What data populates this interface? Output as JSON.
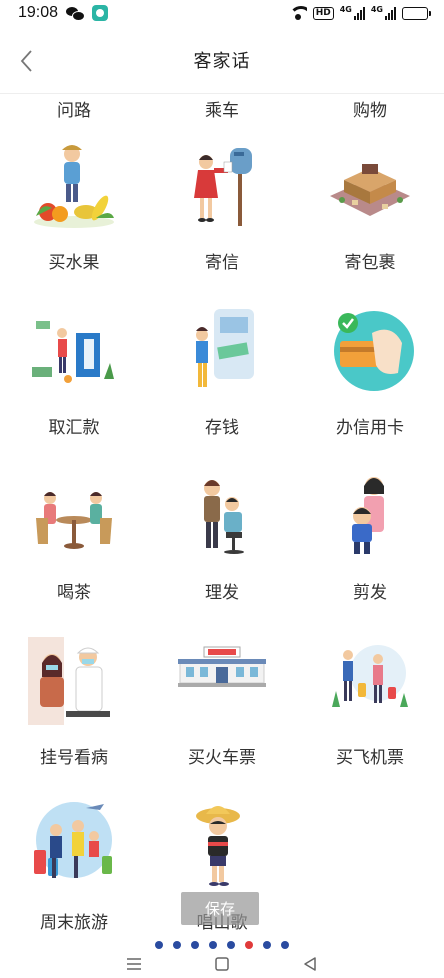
{
  "status_bar": {
    "time": "19:08",
    "hd_label": "HD",
    "signal_1": "4G",
    "signal_2": "4G"
  },
  "header": {
    "title": "客家话"
  },
  "partial_row": [
    "问路",
    "乘车",
    "购物"
  ],
  "grid": [
    [
      "买水果",
      "寄信",
      "寄包裹"
    ],
    [
      "取汇款",
      "存钱",
      "办信用卡"
    ],
    [
      "喝茶",
      "理发",
      "剪发"
    ],
    [
      "挂号看病",
      "买火车票",
      "买飞机票"
    ],
    [
      "周末旅游",
      "唱山歌"
    ]
  ],
  "save_label": "保存",
  "page_dots": {
    "count": 8,
    "active_index": 5
  },
  "icons": {
    "back": "chevron-left-icon",
    "nav_menu": "menu-icon",
    "nav_home": "home-icon",
    "nav_back": "triangle-back-icon"
  },
  "colors": {
    "dot": "#2a4ba0",
    "dot_active": "#e03a3a",
    "save_overlay": "#969696"
  }
}
